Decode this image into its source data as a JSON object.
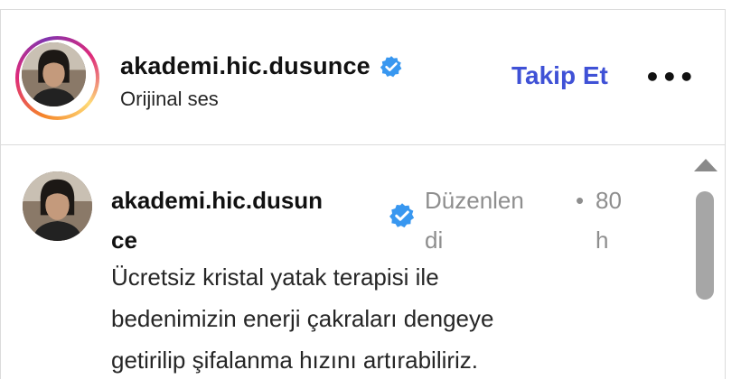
{
  "header": {
    "username": "akademi.hic.dusunce",
    "subtitle": "Orijinal ses",
    "follow_label": "Takip Et",
    "more_label": "•••",
    "avatar_icon": "profile-photo",
    "verified_icon": "verified-badge-icon"
  },
  "comment": {
    "username_line1": "akademi.hic.dusun",
    "username_line2": "ce",
    "edited_line1": "Düzenlen",
    "edited_line2": "di",
    "dot": "•",
    "time_line1": "80",
    "time_line2": "h",
    "text_lines": [
      "Ücretsiz kristal yatak terapisi ile",
      "bedenimizin enerji çakraları dengeye",
      "getirilip şifalanma hızını artırabiliriz."
    ]
  },
  "colors": {
    "accent": "#3f51d6",
    "verified": "#3897f0",
    "muted": "#8e8e8e",
    "border": "#dbdbdb"
  }
}
